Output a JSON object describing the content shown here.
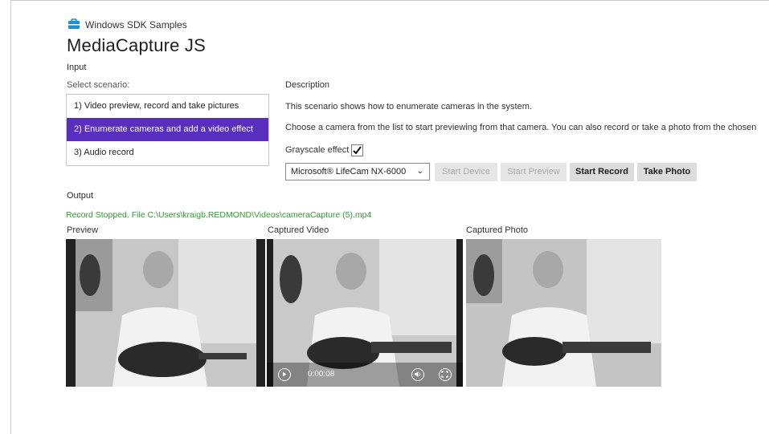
{
  "header": {
    "app_name": "Windows SDK Samples",
    "title": "MediaCapture JS",
    "brand_color": "#1b8fd8"
  },
  "input": {
    "section_label": "Input",
    "select_label": "Select scenario:",
    "scenarios": [
      {
        "label": "1) Video preview, record and take pictures",
        "selected": false
      },
      {
        "label": "2) Enumerate cameras and add a video effect",
        "selected": true
      },
      {
        "label": "3) Audio record",
        "selected": false
      }
    ],
    "selection_color": "#5a2fbf"
  },
  "description": {
    "label": "Description",
    "line1": "This scenario shows how to enumerate cameras in the system.",
    "line2": "Choose a camera from the list to start previewing from that camera. You can also record or take a photo from the chosen"
  },
  "controls": {
    "grayscale_label": "Grayscale effect",
    "grayscale_checked": true,
    "camera_select": "Microsoft® LifeCam NX-6000",
    "buttons": {
      "start_device": "Start Device",
      "start_preview": "Start Preview",
      "start_record": "Start Record",
      "take_photo": "Take Photo"
    }
  },
  "output": {
    "section_label": "Output",
    "status": "Record Stopped.  File C:\\Users\\kraigb.REDMOND\\Videos\\cameraCapture (5).mp4",
    "status_color": "#2f9a2f",
    "panels": {
      "preview": "Preview",
      "captured_video": "Captured Video",
      "captured_photo": "Captured Photo"
    },
    "video_time": "0:00:08",
    "icons": {
      "play": "play-icon",
      "volume": "volume-icon",
      "fullscreen": "fullscreen-icon"
    }
  }
}
